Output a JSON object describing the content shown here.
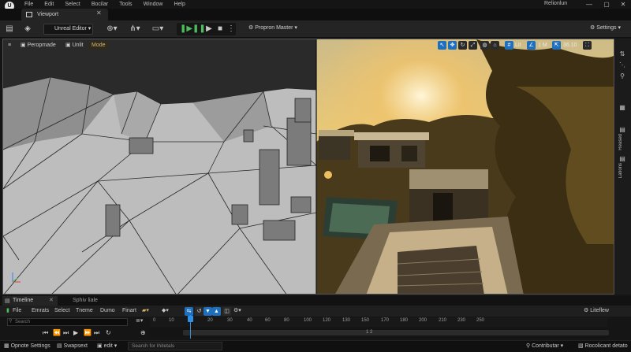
{
  "menubar": {
    "logo": "U",
    "items": [
      "File",
      "Edit",
      "Select",
      "Bocilar",
      "Tools",
      "Window",
      "Help"
    ],
    "project": "Relionlun",
    "window_buttons": [
      "—",
      "▢",
      "✕"
    ]
  },
  "tab": {
    "title": "Viewport",
    "close": "✕"
  },
  "toolbar": {
    "mode": "Unreal Editor",
    "platform": "Propron Master",
    "settings": "Settings"
  },
  "viewport": {
    "left_options": [
      "Peropmade",
      "Unlit",
      "Mode"
    ],
    "right_values": {
      "snap": "Lit",
      "scale": "1 M",
      "fov": "36.10"
    }
  },
  "right_panel": {
    "labels": [
      "Reased",
      "Lations"
    ]
  },
  "timeline": {
    "tab_active": "Timeline",
    "tab_other": "Sphiv liale",
    "menu": [
      "File",
      "Emrats",
      "Select",
      "Tneme",
      "Dumo",
      "Finart"
    ],
    "right_button": "Liteflew",
    "search_placeholder": "Search",
    "ticks": [
      "0",
      "10",
      "10",
      "20",
      "30",
      "40",
      "60",
      "80",
      "100",
      "120",
      "130",
      "150",
      "170",
      "180",
      "200",
      "210",
      "230",
      "250"
    ],
    "track_label": "1 2"
  },
  "statusbar": {
    "items": [
      "Opnote Settings",
      "Swapsext",
      "edit"
    ],
    "cmd_placeholder": "Search for Ihitetals",
    "right_dropdown": "Contributar",
    "right_link": "Rocolicant detato"
  }
}
